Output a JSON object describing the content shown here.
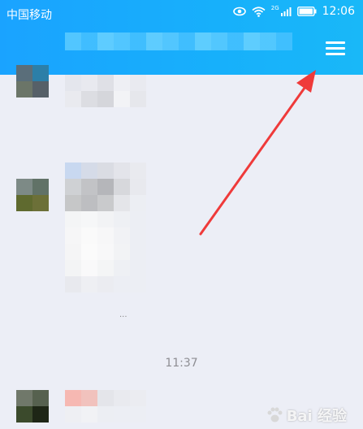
{
  "status_bar": {
    "carrier": "中国移动",
    "network": "2G",
    "time": "12:06",
    "icons": [
      "eye-icon",
      "wifi-icon",
      "signal-icon",
      "battery-icon"
    ]
  },
  "chat": {
    "timestamp": "11:37",
    "ellipsis": "...",
    "messages_pixelated": true
  },
  "header": {
    "menu_icon": "hamburger-menu-icon"
  },
  "annotation": {
    "color": "#ef3a3a",
    "points_to": "hamburger-menu-icon"
  },
  "watermark": {
    "text": "Bai 经验",
    "brand": "baidu-paw-icon"
  },
  "colors": {
    "header_blue": "#1aa3ff",
    "background": "#eceef6"
  }
}
